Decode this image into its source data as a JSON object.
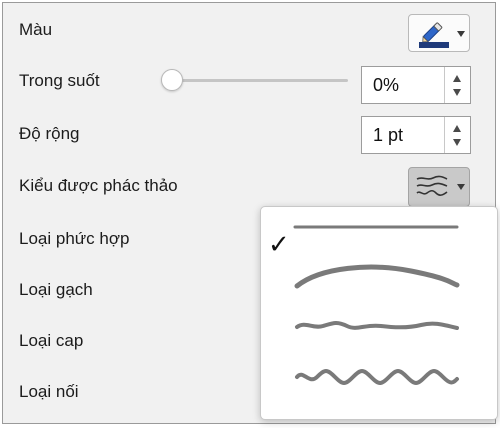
{
  "properties": {
    "color_label": "Màu",
    "transparency_label": "Trong suốt",
    "transparency_value": "0%",
    "transparency_level": 0,
    "width_label": "Độ rộng",
    "width_value": "1 pt",
    "sketch_style_label": "Kiểu được phác thảo",
    "compound_type_label": "Loại phức hợp",
    "dash_type_label": "Loại gạch",
    "cap_type_label": "Loại cap",
    "join_type_label": "Loại nối"
  },
  "color_button": {
    "icon": "pen-icon",
    "swatch_color": "#1f3a7a"
  },
  "sketch_menu": {
    "selected_index": 0,
    "check_glyph": "✓",
    "options": [
      "straight-line",
      "curved-line",
      "freehand-line",
      "scribble-line"
    ]
  },
  "colors": {
    "line_stroke": "#7a7a7a",
    "panel_bg": "#f1f1f1"
  }
}
